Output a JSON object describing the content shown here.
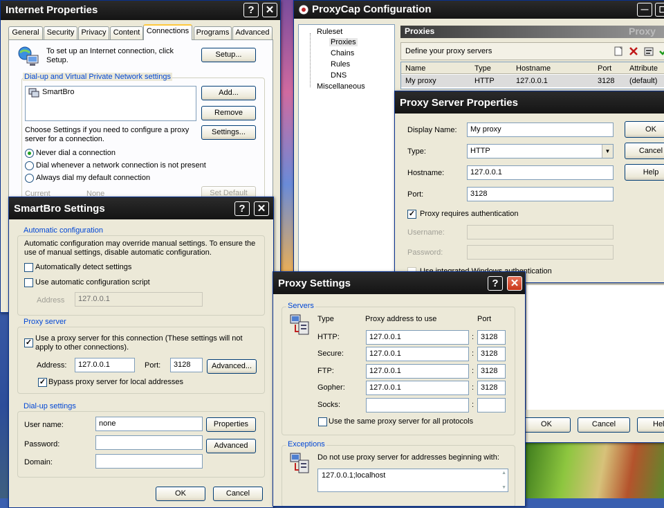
{
  "internet_properties": {
    "title": "Internet Properties",
    "help_symbol": "?",
    "close_symbol": "✕",
    "tabs": [
      "General",
      "Security",
      "Privacy",
      "Content",
      "Connections",
      "Programs",
      "Advanced"
    ],
    "setup_text": "To set up an Internet connection, click Setup.",
    "setup_button": "Setup...",
    "dialup_vpn_label": "Dial-up and Virtual Private Network settings",
    "connections": [
      "SmartBro"
    ],
    "add_button": "Add...",
    "remove_button": "Remove",
    "choose_text": "Choose Settings if you need to configure a proxy server for a connection.",
    "settings_button": "Settings...",
    "radio_never": "Never dial a connection",
    "radio_whenever": "Dial whenever a network connection is not present",
    "radio_always": "Always dial my default connection",
    "current_label": "Current",
    "current_value": "None",
    "set_default_button": "Set Default"
  },
  "proxycap": {
    "title": "ProxyCap Configuration",
    "min_symbol": "—",
    "max_symbol": "☐",
    "tree": {
      "ruleset": "Ruleset",
      "proxies": "Proxies",
      "chains": "Chains",
      "rules": "Rules",
      "dns": "DNS",
      "misc": "Miscellaneous"
    },
    "panel_title": "Proxies",
    "panel_watermark": "Proxy",
    "define_text": "Define your proxy servers",
    "columns": [
      "Name",
      "Type",
      "Hostname",
      "Port",
      "Attribute"
    ],
    "rows": [
      {
        "name": "My proxy",
        "type": "HTTP",
        "hostname": "127.0.0.1",
        "port": "3128",
        "attribute": "(default)"
      }
    ],
    "ok_button": "OK",
    "cancel_button": "Cancel",
    "help_button": "Hel"
  },
  "proxy_server_properties": {
    "title": "Proxy Server Properties",
    "display_name_label": "Display Name:",
    "display_name_value": "My proxy",
    "type_label": "Type:",
    "type_value": "HTTP",
    "hostname_label": "Hostname:",
    "hostname_value": "127.0.0.1",
    "port_label": "Port:",
    "port_value": "3128",
    "requires_auth": "Proxy requires authentication",
    "username_label": "Username:",
    "password_label": "Password:",
    "integrated_auth": "Use integrated Windows authentication",
    "ok_button": "OK",
    "cancel_button": "Cancel",
    "help_button": "Help"
  },
  "smartbro": {
    "title": "SmartBro Settings",
    "help_symbol": "?",
    "close_symbol": "✕",
    "auto_config_label": "Automatic configuration",
    "auto_config_text": "Automatic configuration may override manual settings.  To ensure the use of manual settings, disable automatic configuration.",
    "auto_detect": "Automatically detect settings",
    "auto_script": "Use automatic configuration script",
    "address_label": "Address",
    "script_address": "127.0.0.1",
    "proxy_server_label": "Proxy server",
    "use_proxy_text": "Use a proxy server for this connection (These settings will not apply to other connections).",
    "proxy_address_label": "Address:",
    "proxy_address": "127.0.0.1",
    "proxy_port_label": "Port:",
    "proxy_port": "3128",
    "advanced_button": "Advanced...",
    "bypass_local": "Bypass proxy server for local addresses",
    "dialup_label": "Dial-up settings",
    "username_label": "User name:",
    "username_value": "none",
    "password_label": "Password:",
    "domain_label": "Domain:",
    "properties_button": "Properties",
    "advanced2_button": "Advanced",
    "ok_button": "OK",
    "cancel_button": "Cancel"
  },
  "proxy_settings": {
    "title": "Proxy Settings",
    "help_symbol": "?",
    "close_symbol": "✕",
    "servers_label": "Servers",
    "col_type": "Type",
    "col_address": "Proxy address to use",
    "col_port": "Port",
    "servers": [
      {
        "type": "HTTP:",
        "address": "127.0.0.1",
        "port": "3128"
      },
      {
        "type": "Secure:",
        "address": "127.0.0.1",
        "port": "3128"
      },
      {
        "type": "FTP:",
        "address": "127.0.0.1",
        "port": "3128"
      },
      {
        "type": "Gopher:",
        "address": "127.0.0.1",
        "port": "3128"
      },
      {
        "type": "Socks:",
        "address": "",
        "port": ""
      }
    ],
    "colon": ":",
    "same_proxy": "Use the same proxy server for all protocols",
    "exceptions_label": "Exceptions",
    "exceptions_text": "Do not use proxy server for addresses beginning with:",
    "exceptions_value": "127.0.0.1;localhost"
  },
  "colors": {
    "xp_title_blue": "#0a3fb4",
    "dark_title": "#1c1c1c",
    "group_label_blue": "#0046d5",
    "dialog_face": "#ece9d8"
  }
}
